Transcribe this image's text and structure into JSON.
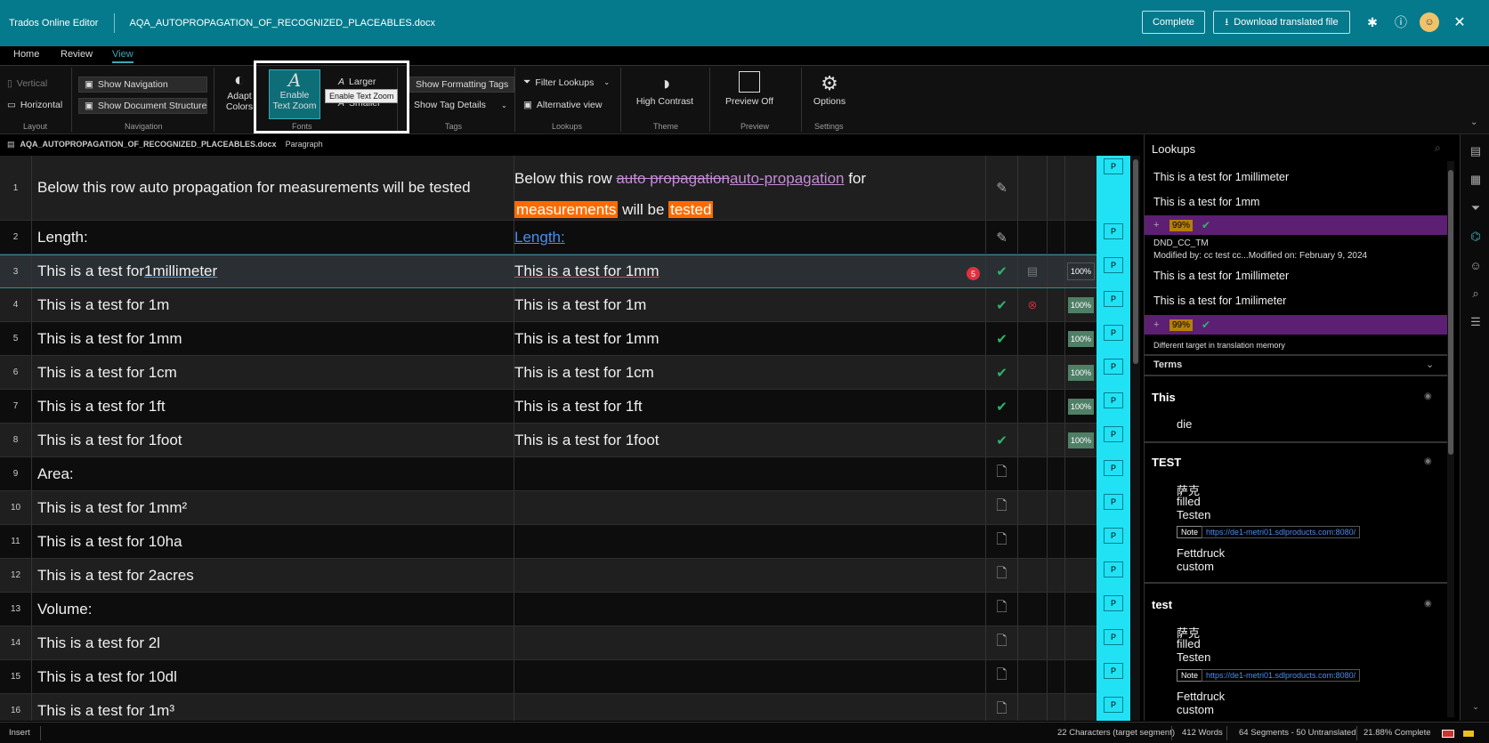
{
  "header": {
    "app_name": "Trados Online Editor",
    "doc_name": "AQA_AUTOPROPAGATION_OF_RECOGNIZED_PLACEABLES.docx",
    "complete_label": "Complete",
    "download_label": "Download translated file"
  },
  "tabs": [
    {
      "label": "Home"
    },
    {
      "label": "Review"
    },
    {
      "label": "View"
    }
  ],
  "ribbon": {
    "layout": {
      "vertical": "Vertical",
      "horizontal": "Horizontal",
      "group": "Layout"
    },
    "navigation": {
      "show_navigation": "Show Navigation",
      "show_document_structure": "Show Document Structure",
      "group": "Navigation"
    },
    "adapt": {
      "line1": "Adapt",
      "line2": "Colors"
    },
    "fonts": {
      "enable_l1": "Enable",
      "enable_l2": "Text Zoom",
      "larger": "Larger",
      "smaller": "Smaller",
      "group": "Fonts",
      "tooltip": "Enable Text Zoom"
    },
    "tags": {
      "show_formatting": "Show Formatting Tags",
      "show_tag_details": "Show Tag Details",
      "group": "Tags"
    },
    "lookups": {
      "filter": "Filter Lookups",
      "alternative": "Alternative view",
      "group": "Lookups"
    },
    "theme": {
      "label": "High Contrast",
      "group": "Theme"
    },
    "preview": {
      "label": "Preview Off",
      "group": "Preview"
    },
    "settings": {
      "label": "Options",
      "group": "Settings"
    }
  },
  "docbar": {
    "file": "AQA_AUTOPROPAGATION_OF_RECOGNIZED_PLACEABLES.docx",
    "structure": "Paragraph"
  },
  "segments": [
    {
      "n": "1",
      "src": "Below this row auto propagation for measurements will be tested",
      "tgt_a": "Below this row ",
      "tgt_del": "auto propagation",
      "tgt_ins": "auto-propagation",
      "tgt_b": " for",
      "tgt_hl1": "measurements",
      "tgt_mid": " will be ",
      "tgt_hl2": "tested",
      "p": "P"
    },
    {
      "n": "2",
      "src": "Length:",
      "tgt": "Length:",
      "p": "P"
    },
    {
      "n": "3",
      "src_a": "This is a test for ",
      "src_u": "1millimeter",
      "tgt": "This is a test for 1mm",
      "badge": "5",
      "mt": "100%",
      "p": "P"
    },
    {
      "n": "4",
      "src": "This is a test for 1m",
      "tgt": "This is a test for 1m",
      "mt": "100%",
      "p": "P"
    },
    {
      "n": "5",
      "src": "This is a test for 1mm",
      "tgt": "This is a test for 1mm",
      "mt": "100%",
      "p": "P"
    },
    {
      "n": "6",
      "src": "This is a test for 1cm",
      "tgt": "This is a test for 1cm",
      "mt": "100%",
      "p": "P"
    },
    {
      "n": "7",
      "src": "This is a test for 1ft",
      "tgt": "This is a test for 1ft",
      "mt": "100%",
      "p": "P"
    },
    {
      "n": "8",
      "src": "This is a test for 1foot",
      "tgt": "This is a test for 1foot",
      "mt": "100%",
      "p": "P"
    },
    {
      "n": "9",
      "src": "Area:",
      "p": "P"
    },
    {
      "n": "10",
      "src": "This is a test for 1mm²",
      "p": "P"
    },
    {
      "n": "11",
      "src": "This is a test for 10ha",
      "p": "P"
    },
    {
      "n": "12",
      "src": "This is a test for 2acres",
      "p": "P"
    },
    {
      "n": "13",
      "src": "Volume:",
      "p": "P"
    },
    {
      "n": "14",
      "src": "This is a test for 2l",
      "p": "P"
    },
    {
      "n": "15",
      "src": "This is a test for 10dl",
      "p": "P"
    },
    {
      "n": "16",
      "src": "This is a test for 1m³",
      "p": "P"
    }
  ],
  "lookups": {
    "title": "Lookups",
    "m1_src": "This is a test for 1millimeter",
    "m1_tgt": "This is a test for 1mm",
    "m1_pct": "99%",
    "m1_tm": "DND_CC_TM",
    "m1_mod": "Modified by: cc test cc...Modified on: February 9, 2024",
    "m2_src": "This is a test for 1millimeter",
    "m2_tgt": "This is a test for 1milimeter",
    "m2_pct": "99%",
    "m2_note": "Different target in translation memory",
    "terms_label": "Terms",
    "t1_head": "This",
    "t1_v1": "die",
    "t2_head": "TEST",
    "t2_v1": "萨克",
    "t2_v2": "filled",
    "t2_v3": "Testen",
    "t2_note": "Note",
    "t2_url": "https://de1-metri01.sdlproducts.com:8080/",
    "t2_v4": "Fettdruck",
    "t2_v5": "custom",
    "t3_head": "test",
    "t3_v1": "萨克",
    "t3_v2": "filled",
    "t3_v3": "Testen",
    "t3_note": "Note",
    "t3_url": "https://de1-metri01.sdlproducts.com:8080/",
    "t3_v4": "Fettdruck",
    "t3_v5": "custom"
  },
  "status": {
    "mode": "Insert",
    "chars": "22 Characters (target segment)",
    "words": "412 Words",
    "segments": "64 Segments - 50 Untranslated",
    "complete": "21.88% Complete"
  }
}
